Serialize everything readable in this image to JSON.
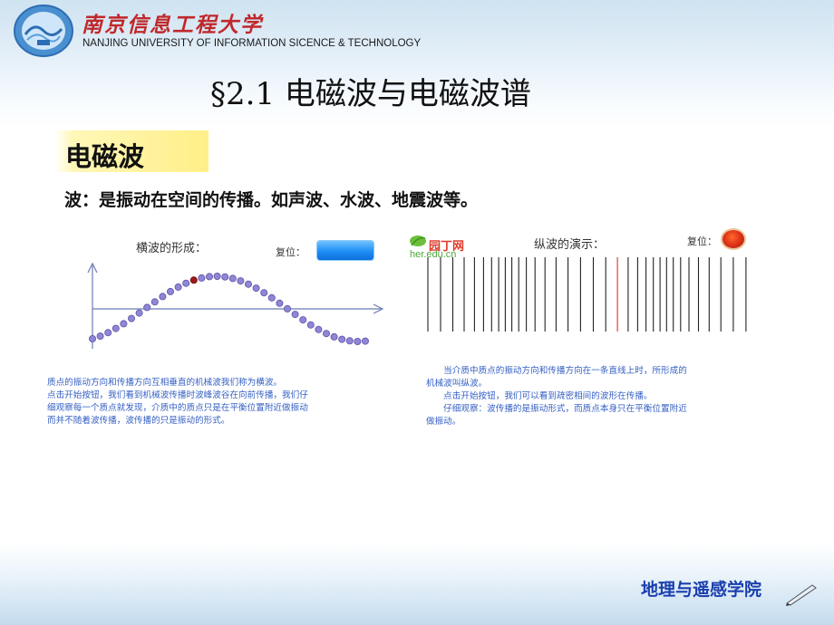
{
  "header": {
    "university_cn": "南京信息工程大学",
    "university_en": "NANJING UNIVERSITY OF INFORMATION SICENCE & TECHNOLOGY"
  },
  "slide": {
    "title": "§2.1 电磁波与电磁波谱",
    "section_label": "电磁波",
    "definition": "波：是振动在空间的传播。如声波、水波、地震波等。"
  },
  "transverse_panel": {
    "title": "横波的形成：",
    "reset_label": "复位：",
    "caption": [
      "质点的振动方向和传播方向互相垂直的机械波我们称为横波。",
      "点击开始按钮，我们看到机械波传播时波峰波谷在向前传播，我们仔",
      "细观察每一个质点就发现，介质中的质点只是在平衡位置附近做振动",
      "而并不随着波传播，波传播的只是振动的形式。"
    ]
  },
  "longitudinal_panel": {
    "site_name": "园丁网",
    "site_url": "her.edu.cn",
    "title": "纵波的演示：",
    "reset_label": "复位：",
    "caption": [
      "　　当介质中质点的振动方向和传播方向在一条直线上时，所形成的",
      "机械波叫纵波。",
      "　　点击开始按钮，我们可以看到疏密相间的波形在传播。",
      "　　仔细观察：波传播的是振动形式，而质点本身只在平衡位置附近",
      "做振动。"
    ]
  },
  "footer": {
    "college": "地理与遥感学院"
  }
}
